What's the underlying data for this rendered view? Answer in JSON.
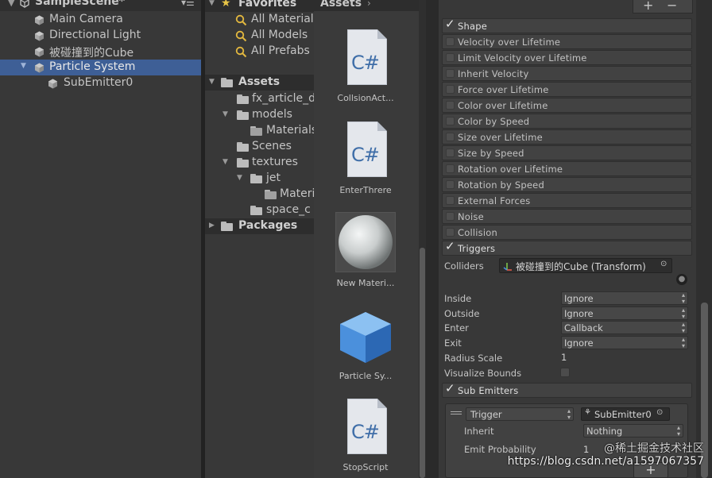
{
  "hierarchy": {
    "scene_title": "SampleScene*",
    "menu_icon": "list-menu-icon",
    "items": [
      {
        "label": "Main Camera"
      },
      {
        "label": "Directional Light"
      },
      {
        "label": "被碰撞到的Cube"
      },
      {
        "label": "Particle System"
      },
      {
        "label": "SubEmitter0"
      }
    ]
  },
  "project": {
    "tree": [
      {
        "label": "Favorites"
      },
      {
        "label": "All Materials"
      },
      {
        "label": "All Models"
      },
      {
        "label": "All Prefabs"
      },
      {
        "label": "Assets"
      },
      {
        "label": "fx_article_d"
      },
      {
        "label": "models"
      },
      {
        "label": "Materials"
      },
      {
        "label": "Scenes"
      },
      {
        "label": "textures"
      },
      {
        "label": "jet"
      },
      {
        "label": "Materi"
      },
      {
        "label": "space_c"
      },
      {
        "label": "Packages"
      }
    ],
    "breadcrumb": "Assets",
    "assets": [
      {
        "name": "CollsionAct...",
        "cs": "C#"
      },
      {
        "name": "EnterThrere",
        "cs": "C#"
      },
      {
        "name": "New Materi..."
      },
      {
        "name": "Particle Sy..."
      },
      {
        "name": "StopScript",
        "cs": "C#"
      }
    ]
  },
  "inspector": {
    "top_buttons": {
      "add": "+",
      "remove": "−"
    },
    "modules": [
      {
        "label": "Shape",
        "checked": true
      },
      {
        "label": "Velocity over Lifetime"
      },
      {
        "label": "Limit Velocity over Lifetime"
      },
      {
        "label": "Inherit Velocity"
      },
      {
        "label": "Force over Lifetime"
      },
      {
        "label": "Color over Lifetime"
      },
      {
        "label": "Color by Speed"
      },
      {
        "label": "Size over Lifetime"
      },
      {
        "label": "Size by Speed"
      },
      {
        "label": "Rotation over Lifetime"
      },
      {
        "label": "Rotation by Speed"
      },
      {
        "label": "External Forces"
      },
      {
        "label": "Noise"
      },
      {
        "label": "Collision"
      },
      {
        "label": "Triggers",
        "checked": true
      }
    ],
    "triggers": {
      "colliders_label": "Colliders",
      "collider_value": "被碰撞到的Cube (Transform)",
      "inside_label": "Inside",
      "inside_value": "Ignore",
      "outside_label": "Outside",
      "outside_value": "Ignore",
      "enter_label": "Enter",
      "enter_value": "Callback",
      "exit_label": "Exit",
      "exit_value": "Ignore",
      "radius_label": "Radius Scale",
      "radius_value": "1",
      "visualize_label": "Visualize Bounds"
    },
    "sub_emitters": {
      "header": "Sub Emitters",
      "type_value": "Trigger",
      "emitter_value": "SubEmitter0",
      "inherit_label": "Inherit",
      "inherit_value": "Nothing",
      "prob_label": "Emit Probability",
      "prob_value": "1",
      "add_label": "+"
    }
  },
  "watermark": "https://blog.csdn.net/a1597067357",
  "watermark_brand": "@稀土掘金技术社区",
  "colors": {
    "selection": "#3e5f96",
    "panel": "#383838",
    "cs_blue": "#3f6ea8"
  }
}
